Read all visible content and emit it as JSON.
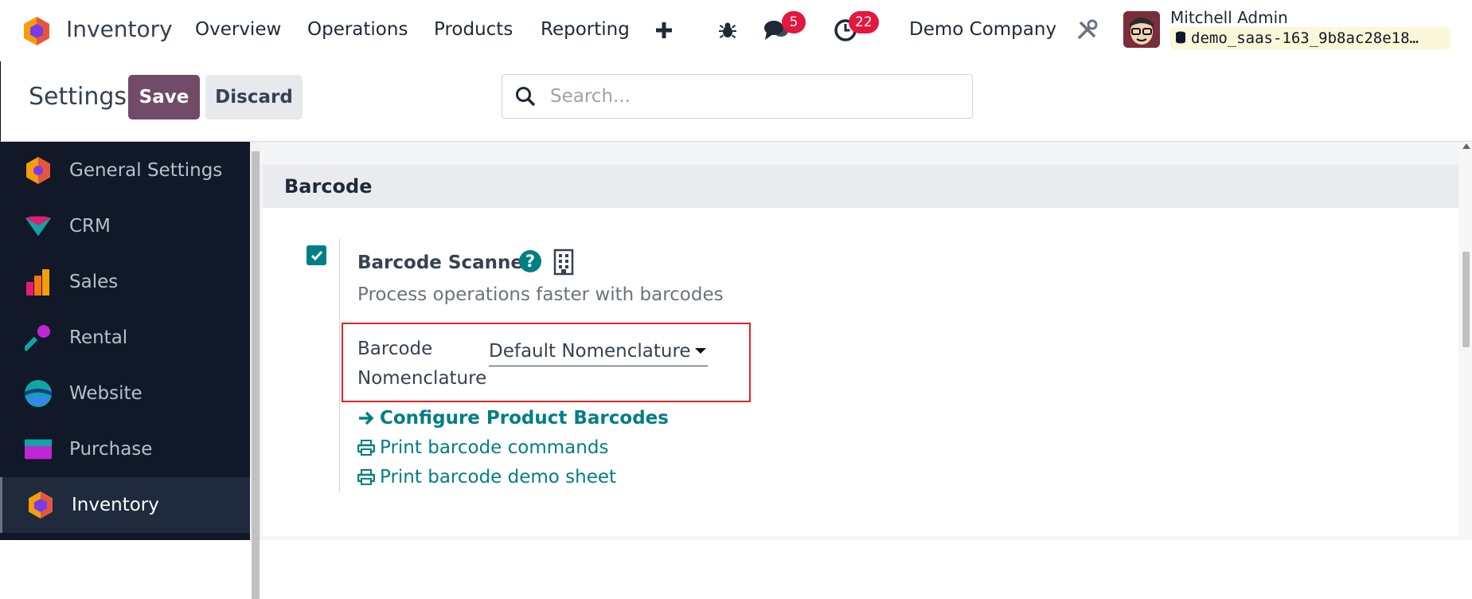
{
  "navbar": {
    "app_name": "Inventory",
    "menu": [
      "Overview",
      "Operations",
      "Products",
      "Reporting"
    ],
    "messages_count": "5",
    "activities_count": "22",
    "company": "Demo Company",
    "user_name": "Mitchell Admin",
    "database": "demo_saas-163_9b8ac28e18…"
  },
  "control_panel": {
    "breadcrumb": "Settings",
    "save_label": "Save",
    "discard_label": "Discard",
    "search_placeholder": "Search..."
  },
  "sidebar": {
    "items": [
      {
        "label": "General Settings",
        "icon": "general-settings-icon"
      },
      {
        "label": "CRM",
        "icon": "crm-icon"
      },
      {
        "label": "Sales",
        "icon": "sales-icon"
      },
      {
        "label": "Rental",
        "icon": "rental-icon"
      },
      {
        "label": "Website",
        "icon": "website-icon"
      },
      {
        "label": "Purchase",
        "icon": "purchase-icon"
      },
      {
        "label": "Inventory",
        "icon": "inventory-icon",
        "active": true
      }
    ]
  },
  "section": {
    "title": "Barcode",
    "setting": {
      "title": "Barcode Scanner",
      "description": "Process operations faster with barcodes",
      "checked": true,
      "field_label_1": "Barcode",
      "field_label_2": "Nomenclature",
      "field_value": "Default Nomenclature",
      "links": [
        "Configure Product Barcodes",
        "Print barcode commands",
        "Print barcode demo sheet"
      ]
    }
  },
  "colors": {
    "primary": "#714b67",
    "accent": "#017e84",
    "badge": "#e4173e",
    "highlight": "#e02424",
    "sidebar_bg": "#111827"
  }
}
